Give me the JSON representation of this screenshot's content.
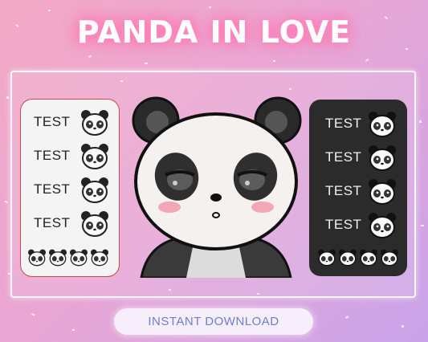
{
  "title": "PANDA IN LOVE",
  "light_panel": {
    "labels": [
      "TEST",
      "TEST",
      "TEST",
      "TEST"
    ]
  },
  "dark_panel": {
    "labels": [
      "TEST",
      "TEST",
      "TEST",
      "TEST"
    ]
  },
  "cta": {
    "label": "INSTANT DOWNLOAD"
  },
  "colors": {
    "background_from": "#f3a9c4",
    "background_to": "#c9a4ea",
    "title_glow": "#ff6fae",
    "panel_light": "#f4f4f4",
    "panel_dark": "#2b2b2b",
    "cta_text": "#6b7fd0"
  },
  "icons": [
    "panda-face-icon",
    "panda-mascot"
  ]
}
